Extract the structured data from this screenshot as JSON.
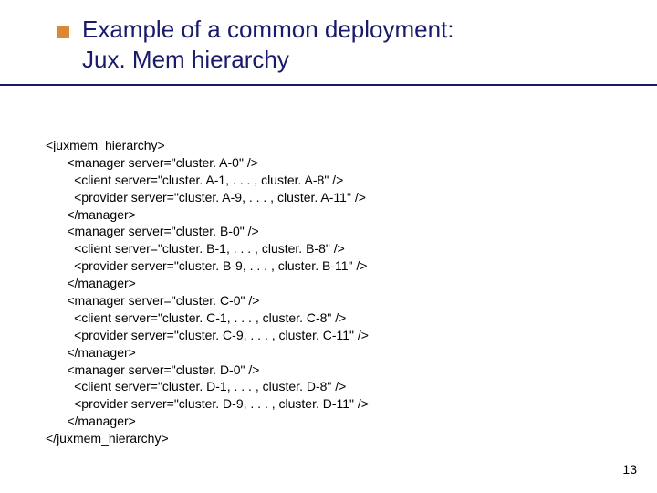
{
  "title": {
    "line1": "Example of a common deployment:",
    "line2": "Jux. Mem hierarchy"
  },
  "code": {
    "root_open": "<juxmem_hierarchy>",
    "mA_open": "<manager server=\"cluster. A-0\" />",
    "mA_client": "<client server=\"cluster. A-1, . . . , cluster. A-8\" />",
    "mA_provider": "<provider server=\"cluster. A-9, . . . , cluster. A-11\" />",
    "mA_close": "</manager>",
    "mB_open": "<manager server=\"cluster. B-0\" />",
    "mB_client": "<client server=\"cluster. B-1, . . . , cluster. B-8\" />",
    "mB_provider": "<provider server=\"cluster. B-9, . . . , cluster. B-11\" />",
    "mB_close": "</manager>",
    "mC_open": "<manager server=\"cluster. C-0\" />",
    "mC_client": "<client server=\"cluster. C-1, . . . , cluster. C-8\" />",
    "mC_provider": "<provider server=\"cluster. C-9, . . . , cluster. C-11\" />",
    "mC_close": "</manager>",
    "mD_open": "<manager server=\"cluster. D-0\" />",
    "mD_client": "<client server=\"cluster. D-1, . . . , cluster. D-8\" />",
    "mD_provider": "<provider server=\"cluster. D-9, . . . , cluster. D-11\" />",
    "mD_close": "</manager>",
    "root_close": "</juxmem_hierarchy>"
  },
  "page_number": "13"
}
